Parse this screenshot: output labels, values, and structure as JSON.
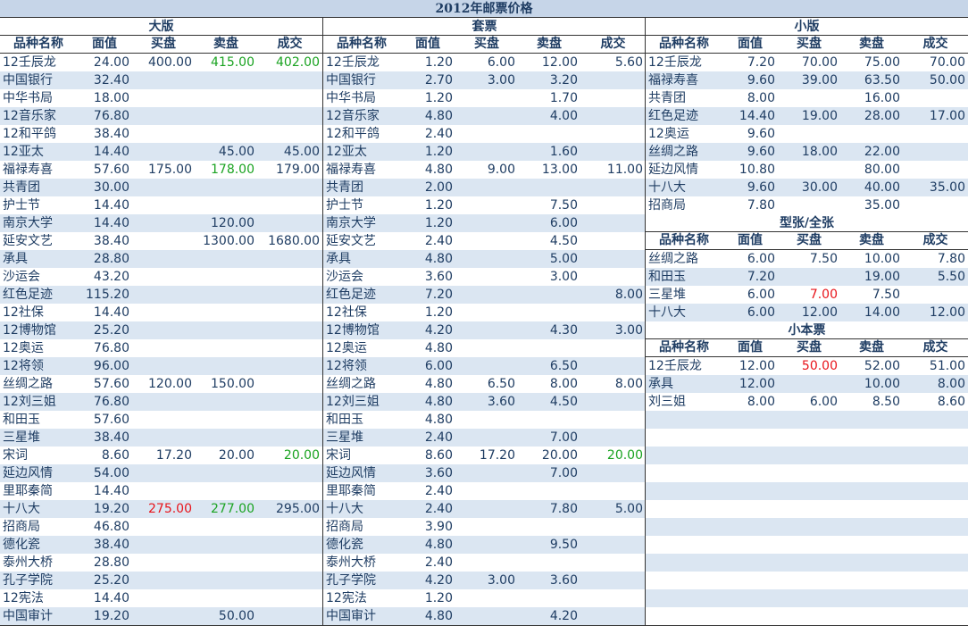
{
  "title": "2012年邮票价格",
  "columns": [
    "品种名称",
    "面值",
    "买盘",
    "卖盘",
    "成交"
  ],
  "colors": {
    "alt_row": "#dbe6f2",
    "header_bg": "#c6d5e8",
    "up": "#1aa321",
    "down": "#e8141b",
    "text": "#1f3d63"
  },
  "sections": {
    "daban": {
      "title": "大版",
      "rows": [
        [
          "12壬辰龙",
          "24.00",
          "400.00",
          "415.00",
          "402.00"
        ],
        [
          "中国银行",
          "32.40",
          "",
          "",
          ""
        ],
        [
          "中华书局",
          "18.00",
          "",
          "",
          ""
        ],
        [
          "12音乐家",
          "76.80",
          "",
          "",
          ""
        ],
        [
          "12和平鸽",
          "38.40",
          "",
          "",
          ""
        ],
        [
          "12亚太",
          "14.40",
          "",
          "45.00",
          "45.00"
        ],
        [
          "福禄寿喜",
          "57.60",
          "175.00",
          "178.00",
          "179.00"
        ],
        [
          "共青团",
          "30.00",
          "",
          "",
          ""
        ],
        [
          "护士节",
          "14.40",
          "",
          "",
          ""
        ],
        [
          "南京大学",
          "14.40",
          "",
          "120.00",
          ""
        ],
        [
          "延安文艺",
          "38.40",
          "",
          "1300.00",
          "1680.00"
        ],
        [
          "承具",
          "28.80",
          "",
          "",
          ""
        ],
        [
          "沙运会",
          "43.20",
          "",
          "",
          ""
        ],
        [
          "红色足迹",
          "115.20",
          "",
          "",
          ""
        ],
        [
          "12社保",
          "14.40",
          "",
          "",
          ""
        ],
        [
          "12博物馆",
          "25.20",
          "",
          "",
          ""
        ],
        [
          "12奥运",
          "76.80",
          "",
          "",
          ""
        ],
        [
          "12将领",
          "96.00",
          "",
          "",
          ""
        ],
        [
          "丝绸之路",
          "57.60",
          "120.00",
          "150.00",
          ""
        ],
        [
          "12刘三姐",
          "76.80",
          "",
          "",
          ""
        ],
        [
          "和田玉",
          "57.60",
          "",
          "",
          ""
        ],
        [
          "三星堆",
          "38.40",
          "",
          "",
          ""
        ],
        [
          "宋词",
          "8.60",
          "17.20",
          "20.00",
          "20.00"
        ],
        [
          "延边风情",
          "54.00",
          "",
          "",
          ""
        ],
        [
          "里耶秦简",
          "14.40",
          "",
          "",
          ""
        ],
        [
          "十八大",
          "19.20",
          "275.00",
          "277.00",
          "295.00"
        ],
        [
          "招商局",
          "46.80",
          "",
          "",
          ""
        ],
        [
          "德化瓷",
          "38.40",
          "",
          "",
          ""
        ],
        [
          "泰州大桥",
          "28.80",
          "",
          "",
          ""
        ],
        [
          "孔子学院",
          "25.20",
          "",
          "",
          ""
        ],
        [
          "12宪法",
          "14.40",
          "",
          "",
          ""
        ],
        [
          "中国审计",
          "19.20",
          "",
          "50.00",
          ""
        ]
      ]
    },
    "taopiao": {
      "title": "套票",
      "rows": [
        [
          "12壬辰龙",
          "1.20",
          "6.00",
          "12.00",
          "5.60"
        ],
        [
          "中国银行",
          "2.70",
          "3.00",
          "3.20",
          ""
        ],
        [
          "中华书局",
          "1.20",
          "",
          "1.70",
          ""
        ],
        [
          "12音乐家",
          "4.80",
          "",
          "4.00",
          ""
        ],
        [
          "12和平鸽",
          "2.40",
          "",
          "",
          ""
        ],
        [
          "12亚太",
          "1.20",
          "",
          "1.60",
          ""
        ],
        [
          "福禄寿喜",
          "4.80",
          "9.00",
          "13.00",
          "11.00"
        ],
        [
          "共青团",
          "2.00",
          "",
          "",
          ""
        ],
        [
          "护士节",
          "1.20",
          "",
          "7.50",
          ""
        ],
        [
          "南京大学",
          "1.20",
          "",
          "6.00",
          ""
        ],
        [
          "延安文艺",
          "2.40",
          "",
          "4.50",
          ""
        ],
        [
          "承具",
          "4.80",
          "",
          "5.00",
          ""
        ],
        [
          "沙运会",
          "3.60",
          "",
          "3.00",
          ""
        ],
        [
          "红色足迹",
          "7.20",
          "",
          "",
          "8.00"
        ],
        [
          "12社保",
          "1.20",
          "",
          "",
          ""
        ],
        [
          "12博物馆",
          "4.20",
          "",
          "4.30",
          "3.00"
        ],
        [
          "12奥运",
          "4.80",
          "",
          "",
          ""
        ],
        [
          "12将领",
          "6.00",
          "",
          "6.50",
          ""
        ],
        [
          "丝绸之路",
          "4.80",
          "6.50",
          "8.00",
          "8.00"
        ],
        [
          "12刘三姐",
          "4.80",
          "3.60",
          "4.50",
          ""
        ],
        [
          "和田玉",
          "4.80",
          "",
          "",
          ""
        ],
        [
          "三星堆",
          "2.40",
          "",
          "7.00",
          ""
        ],
        [
          "宋词",
          "8.60",
          "17.20",
          "20.00",
          "20.00"
        ],
        [
          "延边风情",
          "3.60",
          "",
          "7.00",
          ""
        ],
        [
          "里耶秦简",
          "2.40",
          "",
          "",
          ""
        ],
        [
          "十八大",
          "2.40",
          "",
          "7.80",
          "5.00"
        ],
        [
          "招商局",
          "3.90",
          "",
          "",
          ""
        ],
        [
          "德化瓷",
          "4.80",
          "",
          "9.50",
          ""
        ],
        [
          "泰州大桥",
          "2.40",
          "",
          "",
          ""
        ],
        [
          "孔子学院",
          "4.20",
          "3.00",
          "3.60",
          ""
        ],
        [
          "12宪法",
          "1.20",
          "",
          "",
          ""
        ],
        [
          "中国审计",
          "4.80",
          "",
          "4.20",
          ""
        ]
      ]
    },
    "xiaoban": {
      "title": "小版",
      "rows": [
        [
          "12壬辰龙",
          "7.20",
          "70.00",
          "75.00",
          "70.00"
        ],
        [
          "福禄寿喜",
          "9.60",
          "39.00",
          "63.50",
          "50.00"
        ],
        [
          "共青团",
          "8.00",
          "",
          "16.00",
          ""
        ],
        [
          "红色足迹",
          "14.40",
          "19.00",
          "28.00",
          "17.00"
        ],
        [
          "12奥运",
          "9.60",
          "",
          "",
          ""
        ],
        [
          "丝绸之路",
          "9.60",
          "18.00",
          "22.00",
          ""
        ],
        [
          "延边风情",
          "10.80",
          "",
          "80.00",
          ""
        ],
        [
          "十八大",
          "9.60",
          "30.00",
          "40.00",
          "35.00"
        ],
        [
          "招商局",
          "7.80",
          "",
          "35.00",
          ""
        ]
      ]
    },
    "xingzhang": {
      "title": "型张/全张",
      "rows": [
        [
          "丝绸之路",
          "6.00",
          "7.50",
          "10.00",
          "7.80"
        ],
        [
          "和田玉",
          "7.20",
          "",
          "19.00",
          "5.50"
        ],
        [
          "三星堆",
          "6.00",
          "7.00",
          "7.50",
          ""
        ],
        [
          "十八大",
          "6.00",
          "12.00",
          "14.00",
          "12.00"
        ]
      ]
    },
    "xiaobenpiao": {
      "title": "小本票",
      "rows": [
        [
          "12壬辰龙",
          "12.00",
          "50.00",
          "52.00",
          "51.00"
        ],
        [
          "承具",
          "12.00",
          "",
          "10.00",
          "8.00"
        ],
        [
          "刘三姐",
          "8.00",
          "6.00",
          "8.50",
          "8.60"
        ]
      ]
    }
  },
  "highlights": {
    "green": [
      "daban.0.3",
      "daban.0.4",
      "daban.6.3",
      "daban.22.4",
      "daban.25.3",
      "taopiao.22.4"
    ],
    "red": [
      "daban.25.2",
      "xingzhang.2.2",
      "xiaobenpiao.0.2"
    ]
  }
}
